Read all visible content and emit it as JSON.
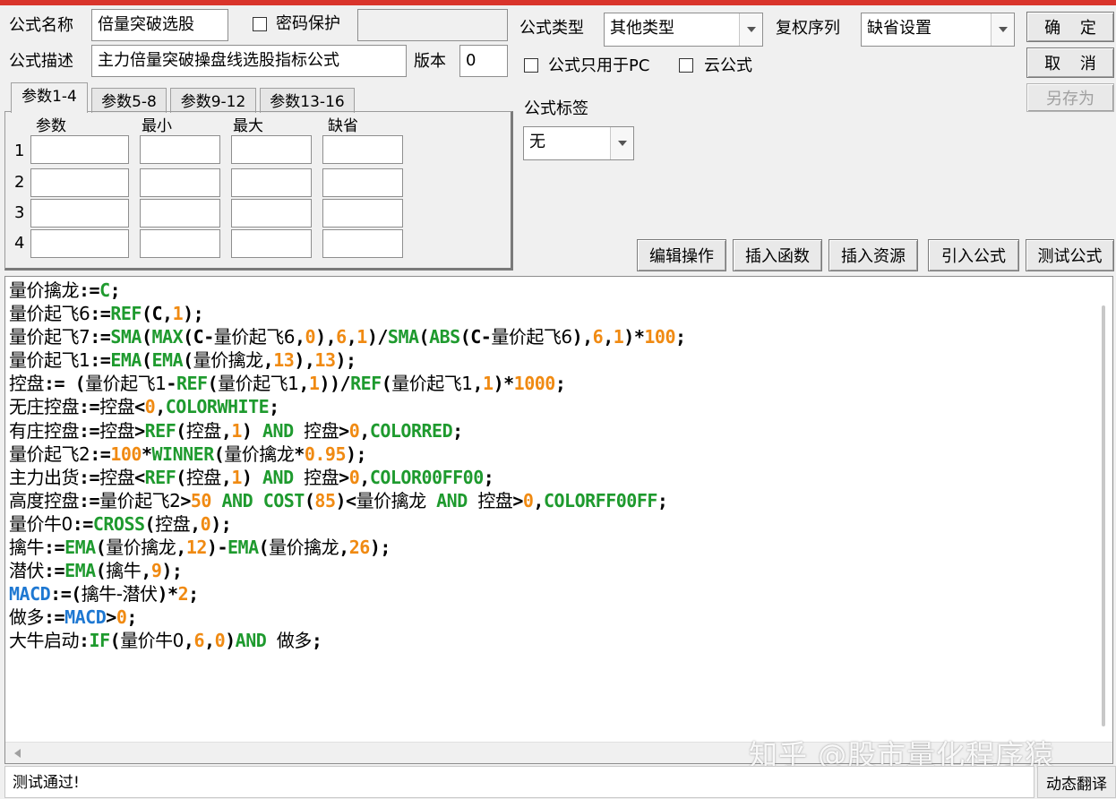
{
  "form": {
    "name_label": "公式名称",
    "name_value": "倍量突破选股",
    "password_label": "密码保护",
    "desc_label": "公式描述",
    "desc_value": "主力倍量突破操盘线选股指标公式",
    "version_label": "版本",
    "version_value": "0",
    "type_label": "公式类型",
    "type_value": "其他类型",
    "rights_label": "复权序列",
    "rights_value": "缺省设置",
    "pc_only_label": "公式只用于PC",
    "cloud_label": "云公式",
    "tag_label": "公式标签",
    "tag_value": "无"
  },
  "buttons": {
    "ok": "确 定",
    "cancel": "取 消",
    "save_as": "另存为",
    "edit_ops": "编辑操作",
    "insert_func": "插入函数",
    "insert_res": "插入资源",
    "import": "引入公式",
    "test": "测试公式"
  },
  "tabs": [
    "参数1-4",
    "参数5-8",
    "参数9-12",
    "参数13-16"
  ],
  "param_headers": [
    "参数",
    "最小",
    "最大",
    "缺省"
  ],
  "param_rows": [
    "1",
    "2",
    "3",
    "4"
  ],
  "colors": {
    "function": "#1e9a2e",
    "number": "#f08a12",
    "macd": "#1e78d2",
    "titlebar": "#d9342b"
  },
  "code_lines": [
    [
      [
        "v",
        "量价擒龙"
      ],
      [
        "o",
        ":="
      ],
      [
        "f",
        "C"
      ],
      [
        "o",
        ";"
      ]
    ],
    [
      [
        "v",
        "量价起飞6"
      ],
      [
        "o",
        ":="
      ],
      [
        "f",
        "REF"
      ],
      [
        "o",
        "(C,"
      ],
      [
        "n",
        "1"
      ],
      [
        "o",
        ");"
      ]
    ],
    [
      [
        "v",
        "量价起飞7"
      ],
      [
        "o",
        ":="
      ],
      [
        "f",
        "SMA"
      ],
      [
        "o",
        "("
      ],
      [
        "f",
        "MAX"
      ],
      [
        "o",
        "(C-"
      ],
      [
        "v",
        "量价起飞6"
      ],
      [
        "o",
        ","
      ],
      [
        "n",
        "0"
      ],
      [
        "o",
        "),"
      ],
      [
        "n",
        "6"
      ],
      [
        "o",
        ","
      ],
      [
        "n",
        "1"
      ],
      [
        "o",
        ")/"
      ],
      [
        "f",
        "SMA"
      ],
      [
        "o",
        "("
      ],
      [
        "f",
        "ABS"
      ],
      [
        "o",
        "(C-"
      ],
      [
        "v",
        "量价起飞6"
      ],
      [
        "o",
        "),"
      ],
      [
        "n",
        "6"
      ],
      [
        "o",
        ","
      ],
      [
        "n",
        "1"
      ],
      [
        "o",
        ")*"
      ],
      [
        "n",
        "100"
      ],
      [
        "o",
        ";"
      ]
    ],
    [
      [
        "v",
        "量价起飞1"
      ],
      [
        "o",
        ":="
      ],
      [
        "f",
        "EMA"
      ],
      [
        "o",
        "("
      ],
      [
        "f",
        "EMA"
      ],
      [
        "o",
        "("
      ],
      [
        "v",
        "量价擒龙"
      ],
      [
        "o",
        ","
      ],
      [
        "n",
        "13"
      ],
      [
        "o",
        "),"
      ],
      [
        "n",
        "13"
      ],
      [
        "o",
        ");"
      ]
    ],
    [
      [
        "v",
        "控盘"
      ],
      [
        "o",
        ":= ("
      ],
      [
        "v",
        "量价起飞1"
      ],
      [
        "o",
        "-"
      ],
      [
        "f",
        "REF"
      ],
      [
        "o",
        "("
      ],
      [
        "v",
        "量价起飞1"
      ],
      [
        "o",
        ","
      ],
      [
        "n",
        "1"
      ],
      [
        "o",
        "))/"
      ],
      [
        "f",
        "REF"
      ],
      [
        "o",
        "("
      ],
      [
        "v",
        "量价起飞1"
      ],
      [
        "o",
        ","
      ],
      [
        "n",
        "1"
      ],
      [
        "o",
        ")*"
      ],
      [
        "n",
        "1000"
      ],
      [
        "o",
        ";"
      ]
    ],
    [
      [
        "v",
        "无庄控盘"
      ],
      [
        "o",
        ":="
      ],
      [
        "v",
        "控盘"
      ],
      [
        "o",
        "<"
      ],
      [
        "n",
        "0"
      ],
      [
        "o",
        ","
      ],
      [
        "f",
        "COLORWHITE"
      ],
      [
        "o",
        ";"
      ]
    ],
    [
      [
        "v",
        "有庄控盘"
      ],
      [
        "o",
        ":="
      ],
      [
        "v",
        "控盘"
      ],
      [
        "o",
        ">"
      ],
      [
        "f",
        "REF"
      ],
      [
        "o",
        "("
      ],
      [
        "v",
        "控盘"
      ],
      [
        "o",
        ","
      ],
      [
        "n",
        "1"
      ],
      [
        "o",
        ") "
      ],
      [
        "f",
        "AND"
      ],
      [
        "o",
        " "
      ],
      [
        "v",
        "控盘"
      ],
      [
        "o",
        ">"
      ],
      [
        "n",
        "0"
      ],
      [
        "o",
        ","
      ],
      [
        "f",
        "COLORRED"
      ],
      [
        "o",
        ";"
      ]
    ],
    [
      [
        "v",
        "量价起飞2"
      ],
      [
        "o",
        ":="
      ],
      [
        "n",
        "100"
      ],
      [
        "o",
        "*"
      ],
      [
        "f",
        "WINNER"
      ],
      [
        "o",
        "("
      ],
      [
        "v",
        "量价擒龙"
      ],
      [
        "o",
        "*"
      ],
      [
        "n",
        "0.95"
      ],
      [
        "o",
        ");"
      ]
    ],
    [
      [
        "v",
        "主力出货"
      ],
      [
        "o",
        ":="
      ],
      [
        "v",
        "控盘"
      ],
      [
        "o",
        "<"
      ],
      [
        "f",
        "REF"
      ],
      [
        "o",
        "("
      ],
      [
        "v",
        "控盘"
      ],
      [
        "o",
        ","
      ],
      [
        "n",
        "1"
      ],
      [
        "o",
        ") "
      ],
      [
        "f",
        "AND"
      ],
      [
        "o",
        " "
      ],
      [
        "v",
        "控盘"
      ],
      [
        "o",
        ">"
      ],
      [
        "n",
        "0"
      ],
      [
        "o",
        ","
      ],
      [
        "f",
        "COLOR00FF00"
      ],
      [
        "o",
        ";"
      ]
    ],
    [
      [
        "v",
        "高度控盘"
      ],
      [
        "o",
        ":="
      ],
      [
        "v",
        "量价起飞2"
      ],
      [
        "o",
        ">"
      ],
      [
        "n",
        "50"
      ],
      [
        "o",
        " "
      ],
      [
        "f",
        "AND"
      ],
      [
        "o",
        " "
      ],
      [
        "f",
        "COST"
      ],
      [
        "o",
        "("
      ],
      [
        "n",
        "85"
      ],
      [
        "o",
        ")<"
      ],
      [
        "v",
        "量价擒龙"
      ],
      [
        "o",
        " "
      ],
      [
        "f",
        "AND"
      ],
      [
        "o",
        " "
      ],
      [
        "v",
        "控盘"
      ],
      [
        "o",
        ">"
      ],
      [
        "n",
        "0"
      ],
      [
        "o",
        ","
      ],
      [
        "f",
        "COLORFF00FF"
      ],
      [
        "o",
        ";"
      ]
    ],
    [
      [
        "v",
        "量价牛0"
      ],
      [
        "o",
        ":="
      ],
      [
        "f",
        "CROSS"
      ],
      [
        "o",
        "("
      ],
      [
        "v",
        "控盘"
      ],
      [
        "o",
        ","
      ],
      [
        "n",
        "0"
      ],
      [
        "o",
        ");"
      ]
    ],
    [
      [
        "v",
        "擒牛"
      ],
      [
        "o",
        ":="
      ],
      [
        "f",
        "EMA"
      ],
      [
        "o",
        "("
      ],
      [
        "v",
        "量价擒龙"
      ],
      [
        "o",
        ","
      ],
      [
        "n",
        "12"
      ],
      [
        "o",
        ")-"
      ],
      [
        "f",
        "EMA"
      ],
      [
        "o",
        "("
      ],
      [
        "v",
        "量价擒龙"
      ],
      [
        "o",
        ","
      ],
      [
        "n",
        "26"
      ],
      [
        "o",
        ");"
      ]
    ],
    [
      [
        "v",
        "潜伏"
      ],
      [
        "o",
        ":="
      ],
      [
        "f",
        "EMA"
      ],
      [
        "o",
        "("
      ],
      [
        "v",
        "擒牛"
      ],
      [
        "o",
        ","
      ],
      [
        "n",
        "9"
      ],
      [
        "o",
        ");"
      ]
    ],
    [
      [
        "m",
        "MACD"
      ],
      [
        "o",
        ":=("
      ],
      [
        "v",
        "擒牛-潜伏"
      ],
      [
        "o",
        ")*"
      ],
      [
        "n",
        "2"
      ],
      [
        "o",
        ";"
      ]
    ],
    [
      [
        "v",
        "做多"
      ],
      [
        "o",
        ":="
      ],
      [
        "m",
        "MACD"
      ],
      [
        "o",
        ">"
      ],
      [
        "n",
        "0"
      ],
      [
        "o",
        ";"
      ]
    ],
    [
      [
        "v",
        "大牛启动"
      ],
      [
        "o",
        ":"
      ],
      [
        "f",
        "IF"
      ],
      [
        "o",
        "("
      ],
      [
        "v",
        "量价牛0"
      ],
      [
        "o",
        ","
      ],
      [
        "n",
        "6"
      ],
      [
        "o",
        ","
      ],
      [
        "n",
        "0"
      ],
      [
        "o",
        ")"
      ],
      [
        "f",
        "AND"
      ],
      [
        "o",
        " "
      ],
      [
        "v",
        "做多"
      ],
      [
        "o",
        ";"
      ]
    ]
  ],
  "watermark": "知乎 @股市量化程序猿",
  "status_text": "测试通过!",
  "status_button": "动态翻译"
}
